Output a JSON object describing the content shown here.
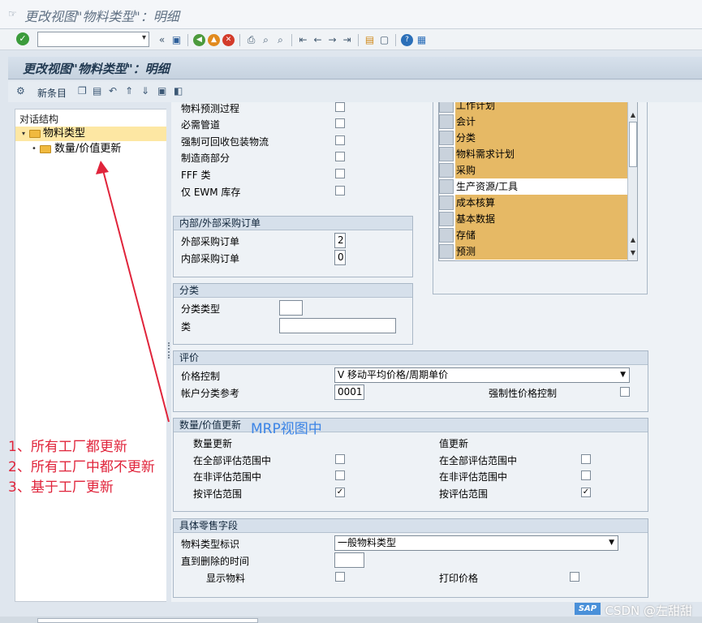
{
  "window": {
    "title": "更改视图\"物料类型\"：明细"
  },
  "system_toolbar": {
    "command_field_value": "",
    "icons": [
      "enter-icon",
      "back-icon",
      "save-icon",
      "back-nav-icon",
      "exit-icon",
      "cancel-icon",
      "print-icon",
      "find-icon",
      "find-next-icon",
      "first-page-icon",
      "previous-page-icon",
      "next-page-icon",
      "last-page-icon",
      "new-session-icon",
      "shortcut-icon",
      "help-icon",
      "layout-icon"
    ]
  },
  "app": {
    "title": "更改视图\"物料类型\"：明细",
    "toolbar": {
      "new_entries_label": "新条目"
    }
  },
  "tree": {
    "header": "对话结构",
    "items": [
      {
        "label": "物料类型",
        "selected": true
      },
      {
        "label": "数量/价值更新",
        "selected": false
      }
    ]
  },
  "top_section": {
    "rows": [
      {
        "label": "物料预测过程",
        "checked": false
      },
      {
        "label": "必需管道",
        "checked": false
      },
      {
        "label": "强制可回收包装物流",
        "checked": false
      },
      {
        "label": "制造商部分",
        "checked": false
      },
      {
        "label": "FFF 类",
        "checked": false
      },
      {
        "label": "仅 EWM 库存",
        "checked": false
      }
    ]
  },
  "view_list": {
    "items": [
      {
        "label": "工作计划",
        "on": true
      },
      {
        "label": "会计",
        "on": true
      },
      {
        "label": "分类",
        "on": true
      },
      {
        "label": "物料需求计划",
        "on": true
      },
      {
        "label": "采购",
        "on": true
      },
      {
        "label": "生产资源/工具",
        "on": false
      },
      {
        "label": "成本核算",
        "on": true
      },
      {
        "label": "基本数据",
        "on": true
      },
      {
        "label": "存储",
        "on": true
      },
      {
        "label": "预测",
        "on": true
      }
    ]
  },
  "purchase_order": {
    "title": "内部/外部采购订单",
    "external_label": "外部采购订单",
    "external_value": "2",
    "internal_label": "内部采购订单",
    "internal_value": "0"
  },
  "classification": {
    "title": "分类",
    "class_type_label": "分类类型",
    "class_type_value": "",
    "class_label": "类",
    "class_value": ""
  },
  "valuation": {
    "title": "评价",
    "price_control_label": "价格控制",
    "price_control_value": "V 移动平均价格/周期单价",
    "acct_cat_ref_label": "帐户分类参考",
    "acct_cat_ref_value": "0001",
    "price_ctrl_mandatory_label": "强制性价格控制",
    "price_ctrl_mandatory_checked": false
  },
  "qty_value_update": {
    "title": "数量/价值更新",
    "qty_header": "数量更新",
    "value_header": "值更新",
    "rows": [
      {
        "label": "在全部评估范围中",
        "qty_checked": false,
        "value_checked": false
      },
      {
        "label": "在非评估范围中",
        "qty_checked": false,
        "value_checked": false
      },
      {
        "label": "按评估范围",
        "qty_checked": true,
        "value_checked": true
      }
    ]
  },
  "retail": {
    "title": "具体零售字段",
    "material_type_id_label": "物料类型标识",
    "material_type_id_value": "一般物料类型",
    "time_until_deletion_label": "直到删除的时间",
    "time_until_deletion_value": "",
    "display_material_label": "显示物料",
    "display_material_checked": false,
    "print_price_label": "打印价格",
    "print_price_checked": false
  },
  "annotations": {
    "lines": [
      "1、所有工厂都更新",
      "2、所有工厂中都不更新",
      "3、基于工厂更新"
    ],
    "mrp_note": "MRP视图中",
    "arrow_color": "#e0243b"
  },
  "watermark": "CSDN @左甜甜",
  "logo": "SAP"
}
